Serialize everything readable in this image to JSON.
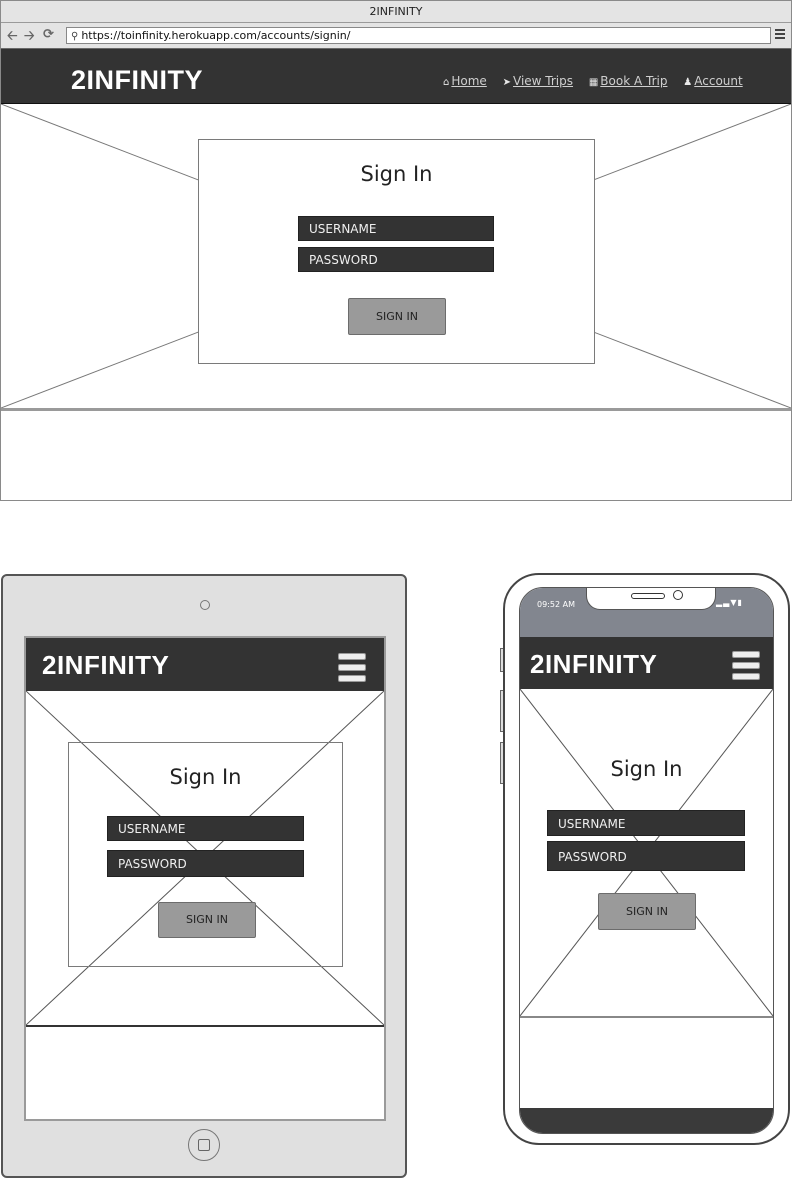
{
  "browser": {
    "window_title": "2INFINITY",
    "url": "https://toinfinity.herokuapp.com/accounts/signin/",
    "nav_icons": [
      "back-arrow-icon",
      "forward-arrow-icon",
      "reload-icon"
    ],
    "menu_icon": "hamburger-menu-icon"
  },
  "site": {
    "logo": "2INFINITY",
    "nav": [
      {
        "icon": "home-icon",
        "label": "Home"
      },
      {
        "icon": "rocket-icon",
        "label": "View Trips"
      },
      {
        "icon": "calendar-icon",
        "label": "Book A Trip"
      },
      {
        "icon": "user-icon",
        "label": "Account"
      }
    ]
  },
  "signin": {
    "title": "Sign In",
    "username_placeholder": "USERNAME",
    "password_placeholder": "PASSWORD",
    "button_label": "SIGN IN"
  },
  "phone": {
    "status_time": "09:52 AM",
    "status_icons": [
      "signal-icon",
      "wifi-icon",
      "battery-icon"
    ]
  },
  "colors": {
    "header_bg": "#333333",
    "field_bg": "#333333",
    "button_bg": "#9a9a9a",
    "phone_status_bg": "#82868f",
    "tablet_bezel": "#e0e0e0"
  }
}
